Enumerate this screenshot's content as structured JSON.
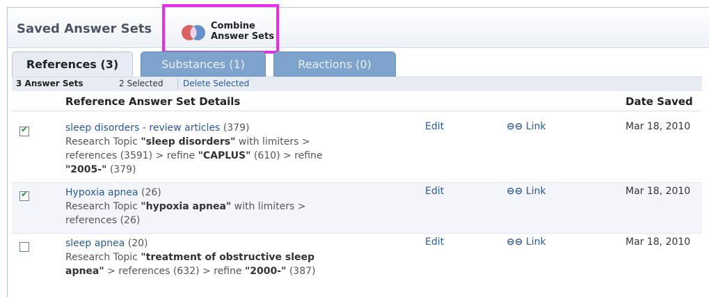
{
  "header": {
    "title": "Saved Answer Sets",
    "combine_line1": "Combine",
    "combine_line2": "Answer Sets"
  },
  "tabs": [
    {
      "label": "References (3)",
      "active": true
    },
    {
      "label": "Substances (1)",
      "active": false
    },
    {
      "label": "Reactions (0)",
      "active": false
    }
  ],
  "strip": {
    "count": "3 Answer Sets",
    "selected": "2 Selected",
    "delete": "Delete Selected"
  },
  "columns": {
    "details": "Reference Answer Set Details",
    "date": "Date Saved"
  },
  "actions": {
    "edit": "Edit",
    "link": "Link"
  },
  "rows": [
    {
      "checked": true,
      "name": "sleep disorders - review articles",
      "count": "(379)",
      "desc": [
        {
          "t": "Research Topic "
        },
        {
          "b": "\"sleep disorders\""
        },
        {
          "t": " with limiters > references (3591) > refine "
        },
        {
          "b": "\"CAPLUS\""
        },
        {
          "t": " (610) > refine "
        },
        {
          "b": "\"2005-\""
        },
        {
          "t": " (379)"
        }
      ],
      "date": "Mar 18, 2010"
    },
    {
      "checked": true,
      "name": "Hypoxia apnea",
      "count": "(26)",
      "desc": [
        {
          "t": "Research Topic "
        },
        {
          "b": "\"hypoxia apnea\""
        },
        {
          "t": " with limiters > references (26)"
        }
      ],
      "date": "Mar 18, 2010"
    },
    {
      "checked": false,
      "name": "sleep apnea",
      "count": "(20)",
      "desc": [
        {
          "t": "Research Topic "
        },
        {
          "b": "\"treatment of obstructive sleep apnea\""
        },
        {
          "t": " > references (632) > refine "
        },
        {
          "b": "\"2000-\""
        },
        {
          "t": " (387)"
        }
      ],
      "date": "Mar 18, 2010"
    }
  ],
  "colors": {
    "accent": "#2a5a9a",
    "tab_inactive": "#7ea3cc",
    "highlight": "#ea2bea"
  },
  "icons": [
    "venn-diagram-icon",
    "chain-link-icon",
    "checkbox-icon"
  ]
}
